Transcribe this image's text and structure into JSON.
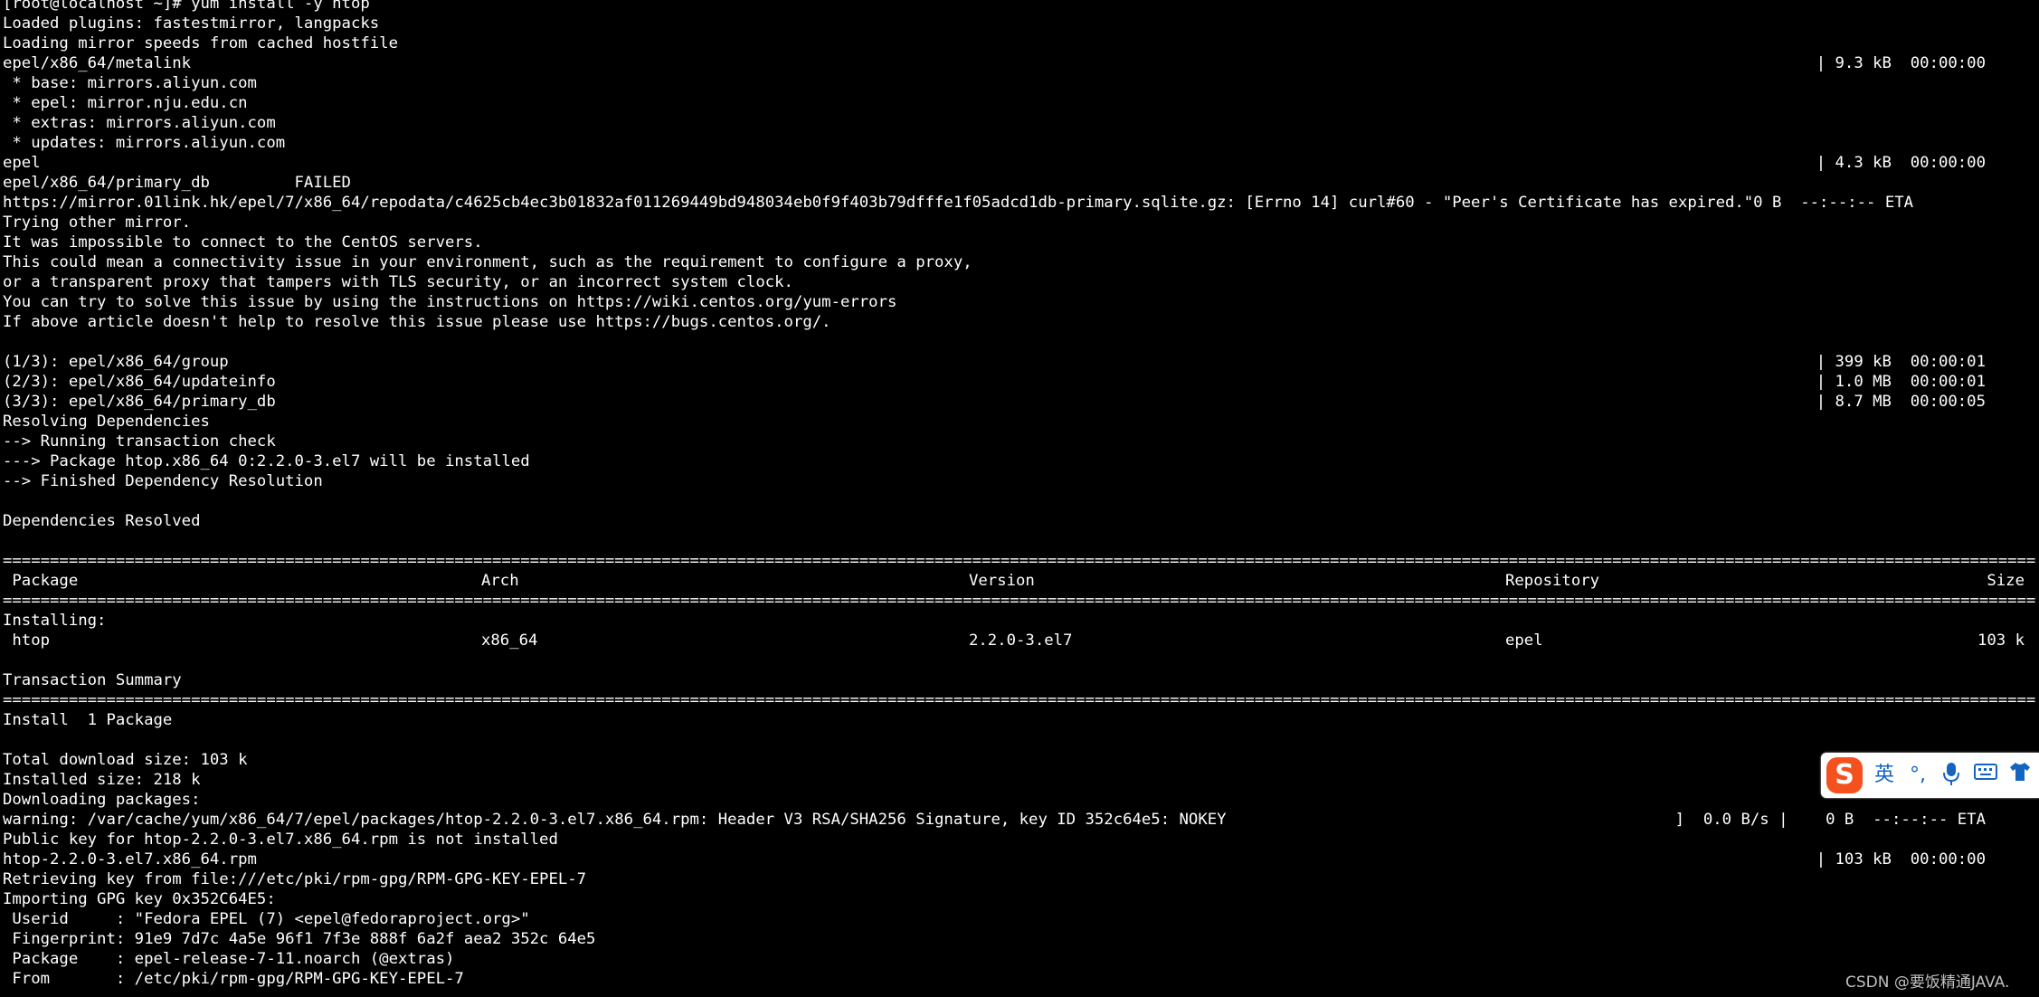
{
  "terminal": {
    "lines": [
      {
        "text": "[root@localhost ~]# yum install -y htop"
      },
      {
        "text": "Loaded plugins: fastestmirror, langpacks"
      },
      {
        "text": "Loading mirror speeds from cached hostfile"
      },
      {
        "text": "epel/x86_64/metalink",
        "right": "| 9.3 kB  00:00:00"
      },
      {
        "text": " * base: mirrors.aliyun.com"
      },
      {
        "text": " * epel: mirror.nju.edu.cn"
      },
      {
        "text": " * extras: mirrors.aliyun.com"
      },
      {
        "text": " * updates: mirrors.aliyun.com"
      },
      {
        "text": "epel",
        "right": "| 4.3 kB  00:00:00"
      },
      {
        "text": "epel/x86_64/primary_db         FAILED"
      },
      {
        "text": "https://mirror.01link.hk/epel/7/x86_64/repodata/c4625cb4ec3b01832af011269449bd948034eb0f9f403b79dfffe1f05adcd1db-primary.sqlite.gz: [Errno 14] curl#60 - \"Peer's Certificate has expired.\"0 B  --:--:-- ETA"
      },
      {
        "text": "Trying other mirror."
      },
      {
        "text": "It was impossible to connect to the CentOS servers."
      },
      {
        "text": "This could mean a connectivity issue in your environment, such as the requirement to configure a proxy,"
      },
      {
        "text": "or a transparent proxy that tampers with TLS security, or an incorrect system clock."
      },
      {
        "text": "You can try to solve this issue by using the instructions on https://wiki.centos.org/yum-errors"
      },
      {
        "text": "If above article doesn't help to resolve this issue please use https://bugs.centos.org/."
      },
      {
        "text": ""
      },
      {
        "text": "(1/3): epel/x86_64/group",
        "right": "| 399 kB  00:00:01"
      },
      {
        "text": "(2/3): epel/x86_64/updateinfo",
        "right": "| 1.0 MB  00:00:01"
      },
      {
        "text": "(3/3): epel/x86_64/primary_db",
        "right": "| 8.7 MB  00:00:05"
      },
      {
        "text": "Resolving Dependencies"
      },
      {
        "text": "--> Running transaction check"
      },
      {
        "text": "---> Package htop.x86_64 0:2.2.0-3.el7 will be installed"
      },
      {
        "text": "--> Finished Dependency Resolution"
      },
      {
        "text": ""
      },
      {
        "text": "Dependencies Resolved"
      },
      {
        "text": ""
      },
      {
        "separator": true
      },
      {
        "columns": [
          " Package",
          "Arch",
          "Version",
          "Repository"
        ],
        "right": "Size"
      },
      {
        "separator": true
      },
      {
        "text": "Installing:"
      },
      {
        "columns": [
          " htop",
          "x86_64",
          "2.2.0-3.el7",
          "epel"
        ],
        "right": "103 k"
      },
      {
        "text": ""
      },
      {
        "text": "Transaction Summary"
      },
      {
        "separator": true
      },
      {
        "text": "Install  1 Package"
      },
      {
        "text": ""
      },
      {
        "text": "Total download size: 103 k"
      },
      {
        "text": "Installed size: 218 k"
      },
      {
        "text": "Downloading packages:"
      },
      {
        "text": "warning: /var/cache/yum/x86_64/7/epel/packages/htop-2.2.0-3.el7.x86_64.rpm: Header V3 RSA/SHA256 Signature, key ID 352c64e5: NOKEY",
        "right": "]  0.0 B/s |    0 B  --:--:-- ETA"
      },
      {
        "text": "Public key for htop-2.2.0-3.el7.x86_64.rpm is not installed"
      },
      {
        "text": "htop-2.2.0-3.el7.x86_64.rpm",
        "right": "| 103 kB  00:00:00"
      },
      {
        "text": "Retrieving key from file:///etc/pki/rpm-gpg/RPM-GPG-KEY-EPEL-7"
      },
      {
        "text": "Importing GPG key 0x352C64E5:"
      },
      {
        "text": " Userid     : \"Fedora EPEL (7) <epel@fedoraproject.org>\""
      },
      {
        "text": " Fingerprint: 91e9 7d7c 4a5e 96f1 7f3e 888f 6a2f aea2 352c 64e5"
      },
      {
        "text": " Package    : epel-release-7-11.noarch (@extras)"
      },
      {
        "text": " From       : /etc/pki/rpm-gpg/RPM-GPG-KEY-EPEL-7"
      }
    ]
  },
  "ime": {
    "logo": "S",
    "mode": "英",
    "punct": "°,",
    "items": [
      "microphone-icon",
      "keyboard-icon",
      "skin-icon"
    ]
  },
  "watermark": "CSDN @要饭精通JAVA.",
  "colors": {
    "background": "#000000",
    "text": "#ffffff",
    "ime_accent": "#1565c0",
    "ime_logo": "#f4511e"
  }
}
